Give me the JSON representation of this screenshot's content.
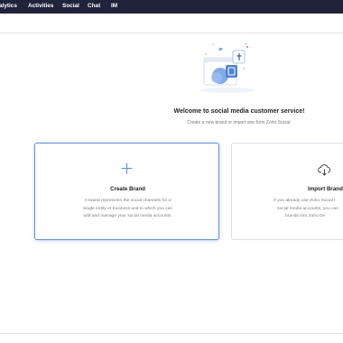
{
  "nav": {
    "items": [
      "alytics",
      "Activities",
      "Social",
      "Chat",
      "IM"
    ]
  },
  "welcome": {
    "title": "Welcome to social media customer service!",
    "subtitle": "Create a new brand or import one from Zoho Social."
  },
  "cards": {
    "create": {
      "title": "Create Brand",
      "desc_line1": "A brand represents the social channels for a",
      "desc_line2": "single entity or business unit to which you can",
      "desc_line3": "add and manage your social media accounts.",
      "icon": "plus-icon"
    },
    "import": {
      "title": "Import Brand",
      "desc_line1": "If you already use Zoho Social t",
      "desc_line2": "social media accounts, you can",
      "desc_line3": "brands into Zoho De",
      "icon": "cloud-download-icon"
    }
  },
  "colors": {
    "topbar": "#20243a",
    "accent": "#5b8fe6",
    "illustration_blue": "#4f83d6"
  }
}
